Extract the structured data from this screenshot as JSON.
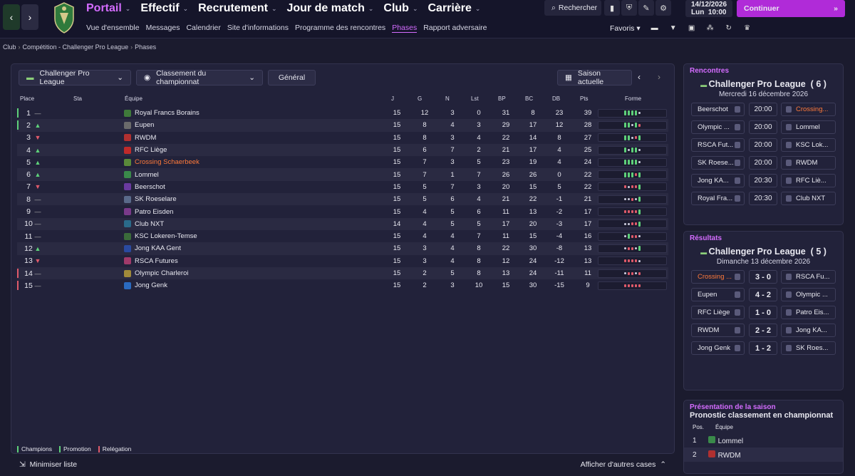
{
  "nav": {
    "menus": [
      {
        "label": "Portail",
        "active": true
      },
      {
        "label": "Effectif",
        "active": false
      },
      {
        "label": "Recrutement",
        "active": false
      },
      {
        "label": "Jour de match",
        "active": false
      },
      {
        "label": "Club",
        "active": false
      },
      {
        "label": "Carrière",
        "active": false
      }
    ],
    "subnav": [
      {
        "label": "Vue d'ensemble",
        "active": false
      },
      {
        "label": "Messages",
        "active": false
      },
      {
        "label": "Calendrier",
        "active": false
      },
      {
        "label": "Site d'informations",
        "active": false
      },
      {
        "label": "Programme des rencontres",
        "active": false
      },
      {
        "label": "Phases",
        "active": true
      },
      {
        "label": "Rapport adversaire",
        "active": false
      }
    ],
    "search_label": "Rechercher",
    "date": "14/12/2026",
    "day_time": "Lun  10:00",
    "continue_label": "Continuer",
    "favorites_label": "Favoris"
  },
  "breadcrumb": [
    "Club",
    "Compétition - Challenger Pro League",
    "Phases"
  ],
  "controls": {
    "competition": "Challenger Pro League",
    "view": "Classement du championnat",
    "general": "Général",
    "season": "Saison actuelle"
  },
  "table": {
    "headers": {
      "place": "Place",
      "sta": "Sta",
      "team": "Équipe",
      "j": "J",
      "g": "G",
      "n": "N",
      "lst": "Lst",
      "bp": "BP",
      "bc": "BC",
      "db": "DB",
      "pts": "Pts",
      "form": "Forme"
    },
    "rows": [
      {
        "place": "1",
        "trend": "—",
        "team": "Royal Francs Borains",
        "j": "15",
        "g": "12",
        "n": "3",
        "lst": "0",
        "bp": "31",
        "bc": "8",
        "db": "23",
        "pts": "39",
        "zone": "champion",
        "form": "WWWWD"
      },
      {
        "place": "2",
        "trend": "▲",
        "team": "Eupen",
        "j": "15",
        "g": "8",
        "n": "4",
        "lst": "3",
        "bp": "29",
        "bc": "17",
        "db": "12",
        "pts": "28",
        "zone": "promotion",
        "form": "WWDWL"
      },
      {
        "place": "3",
        "trend": "▼",
        "team": "RWDM",
        "j": "15",
        "g": "8",
        "n": "3",
        "lst": "4",
        "bp": "22",
        "bc": "14",
        "db": "8",
        "pts": "27",
        "zone": "",
        "form": "WWDLW"
      },
      {
        "place": "4",
        "trend": "▲",
        "team": "RFC Liège",
        "j": "15",
        "g": "6",
        "n": "7",
        "lst": "2",
        "bp": "21",
        "bc": "17",
        "db": "4",
        "pts": "25",
        "zone": "",
        "form": "WDWWD"
      },
      {
        "place": "5",
        "trend": "▲",
        "team": "Crossing Schaerbeek",
        "j": "15",
        "g": "7",
        "n": "3",
        "lst": "5",
        "bp": "23",
        "bc": "19",
        "db": "4",
        "pts": "24",
        "zone": "",
        "form": "WWWWD",
        "highlight": true
      },
      {
        "place": "6",
        "trend": "▲",
        "team": "Lommel",
        "j": "15",
        "g": "7",
        "n": "1",
        "lst": "7",
        "bp": "26",
        "bc": "26",
        "db": "0",
        "pts": "22",
        "zone": "",
        "form": "WWWLW"
      },
      {
        "place": "7",
        "trend": "▼",
        "team": "Beerschot",
        "j": "15",
        "g": "5",
        "n": "7",
        "lst": "3",
        "bp": "20",
        "bc": "15",
        "db": "5",
        "pts": "22",
        "zone": "",
        "form": "LDLLW"
      },
      {
        "place": "8",
        "trend": "—",
        "team": "SK Roeselare",
        "j": "15",
        "g": "5",
        "n": "6",
        "lst": "4",
        "bp": "21",
        "bc": "22",
        "db": "-1",
        "pts": "21",
        "zone": "",
        "form": "DDLDW"
      },
      {
        "place": "9",
        "trend": "—",
        "team": "Patro Eisden",
        "j": "15",
        "g": "4",
        "n": "5",
        "lst": "6",
        "bp": "11",
        "bc": "13",
        "db": "-2",
        "pts": "17",
        "zone": "",
        "form": "LLLLW"
      },
      {
        "place": "10",
        "trend": "—",
        "team": "Club NXT",
        "j": "14",
        "g": "4",
        "n": "5",
        "lst": "5",
        "bp": "17",
        "bc": "20",
        "db": "-3",
        "pts": "17",
        "zone": "",
        "form": "DDLLW"
      },
      {
        "place": "11",
        "trend": "—",
        "team": "KSC Lokeren-Temse",
        "j": "15",
        "g": "4",
        "n": "4",
        "lst": "7",
        "bp": "11",
        "bc": "15",
        "db": "-4",
        "pts": "16",
        "zone": "",
        "form": "DWLLD"
      },
      {
        "place": "12",
        "trend": "▲",
        "team": "Jong KAA Gent",
        "j": "15",
        "g": "3",
        "n": "4",
        "lst": "8",
        "bp": "22",
        "bc": "30",
        "db": "-8",
        "pts": "13",
        "zone": "",
        "form": "DLLDW"
      },
      {
        "place": "13",
        "trend": "▼",
        "team": "RSCA Futures",
        "j": "15",
        "g": "3",
        "n": "4",
        "lst": "8",
        "bp": "12",
        "bc": "24",
        "db": "-12",
        "pts": "13",
        "zone": "",
        "form": "LLLLD"
      },
      {
        "place": "14",
        "trend": "—",
        "team": "Olympic Charleroi",
        "j": "15",
        "g": "2",
        "n": "5",
        "lst": "8",
        "bp": "13",
        "bc": "24",
        "db": "-11",
        "pts": "11",
        "zone": "relegation",
        "form": "DLLDL"
      },
      {
        "place": "15",
        "trend": "—",
        "team": "Jong Genk",
        "j": "15",
        "g": "2",
        "n": "3",
        "lst": "10",
        "bp": "15",
        "bc": "30",
        "db": "-15",
        "pts": "9",
        "zone": "relegation",
        "form": "LLLLL"
      }
    ]
  },
  "legend": {
    "champions": "Champions",
    "promotion": "Promotion",
    "relegation": "Relégation"
  },
  "bottom": {
    "minimize": "Minimiser liste",
    "more": "Afficher d'autres cases"
  },
  "fixtures": {
    "title": "Rencontres",
    "competition": "Challenger Pro League  ( 6 )",
    "date": "Mercredi 16 décembre 2026",
    "matches": [
      {
        "home": "Beerschot",
        "mid": "20:00",
        "away": "Crossing...",
        "away_hl": true
      },
      {
        "home": "Olympic ...",
        "mid": "20:00",
        "away": "Lommel"
      },
      {
        "home": "RSCA Fut...",
        "mid": "20:00",
        "away": "KSC Lok..."
      },
      {
        "home": "SK Roese...",
        "mid": "20:00",
        "away": "RWDM"
      },
      {
        "home": "Jong KA...",
        "mid": "20:30",
        "away": "RFC Liè..."
      },
      {
        "home": "Royal Fra...",
        "mid": "20:30",
        "away": "Club NXT"
      }
    ]
  },
  "results": {
    "title": "Résultats",
    "competition": "Challenger Pro League  ( 5 )",
    "date": "Dimanche 13 décembre 2026",
    "matches": [
      {
        "home": "Crossing ...",
        "mid": "3 - 0",
        "away": "RSCA Fu...",
        "home_hl": true
      },
      {
        "home": "Eupen",
        "mid": "4 - 2",
        "away": "Olympic ..."
      },
      {
        "home": "RFC Liège",
        "mid": "1 - 0",
        "away": "Patro Eis..."
      },
      {
        "home": "RWDM",
        "mid": "2 - 2",
        "away": "Jong KA..."
      },
      {
        "home": "Jong Genk",
        "mid": "1 - 2",
        "away": "SK Roes..."
      }
    ]
  },
  "season": {
    "title": "Présentation de la saison",
    "subtitle": "Pronostic classement en championnat",
    "col_pos": "Pos.",
    "col_team": "Équipe",
    "rows": [
      {
        "pos": "1",
        "team": "Lommel"
      },
      {
        "pos": "2",
        "team": "RWDM"
      }
    ]
  },
  "colors": {
    "accent": "#d46cff",
    "highlight_team": "#ff7a3a",
    "win": "#5ed17a",
    "loss": "#e05a6a",
    "champion": "#5ed17a",
    "relegation": "#e05a6a"
  }
}
